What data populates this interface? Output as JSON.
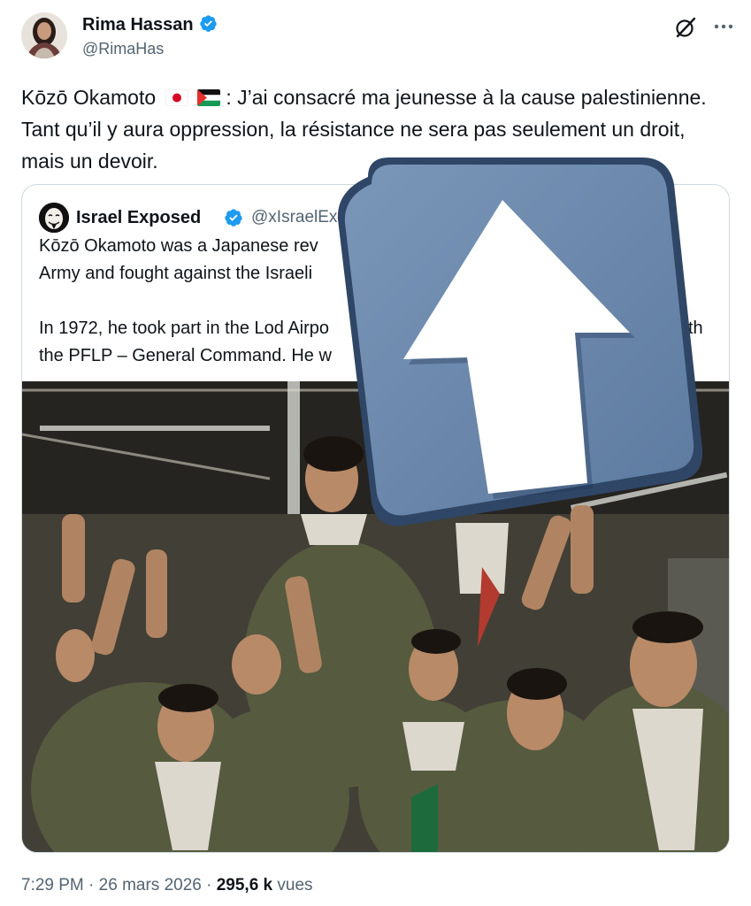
{
  "author": {
    "name": "Rima Hassan",
    "handle": "@RimaHas",
    "avatar": "profile-photo",
    "verified_icon": "verified-badge-icon",
    "verified_color": "#1d9bf0"
  },
  "header_icons": [
    "grok-icon",
    "more-options-icon"
  ],
  "tweet": {
    "text_before_flags": "Kōzō Okamoto",
    "flags": [
      "japan-flag",
      "palestine-flag"
    ],
    "text_after_flags": ": J’ai consacré ma jeunesse à la cause palestinienne. Tant qu’il y aura oppression, la résistance ne sera pas seulement un droit, mais un devoir."
  },
  "quoted_tweet": {
    "name": "Israel Exposed",
    "handle": "@xIsraelEx",
    "avatar": "anonymous-mask-avatar",
    "lines": [
      "Kōzō Okamoto was a Japanese rev",
      "Army and fought against the Israeli",
      "",
      "In 1972, he took part in the Lod Airpo",
      "the PFLP – General Command. He w"
    ],
    "line_fragment_right": "th",
    "photo": "crowd-photo"
  },
  "overlay": {
    "icon": "upvote-arrow-icon",
    "color": "#6b88aa"
  },
  "footer": {
    "time": "7:29 PM",
    "separator": "·",
    "date": "26 mars 2026",
    "views_count": "295,6 k",
    "views_label": "vues"
  }
}
